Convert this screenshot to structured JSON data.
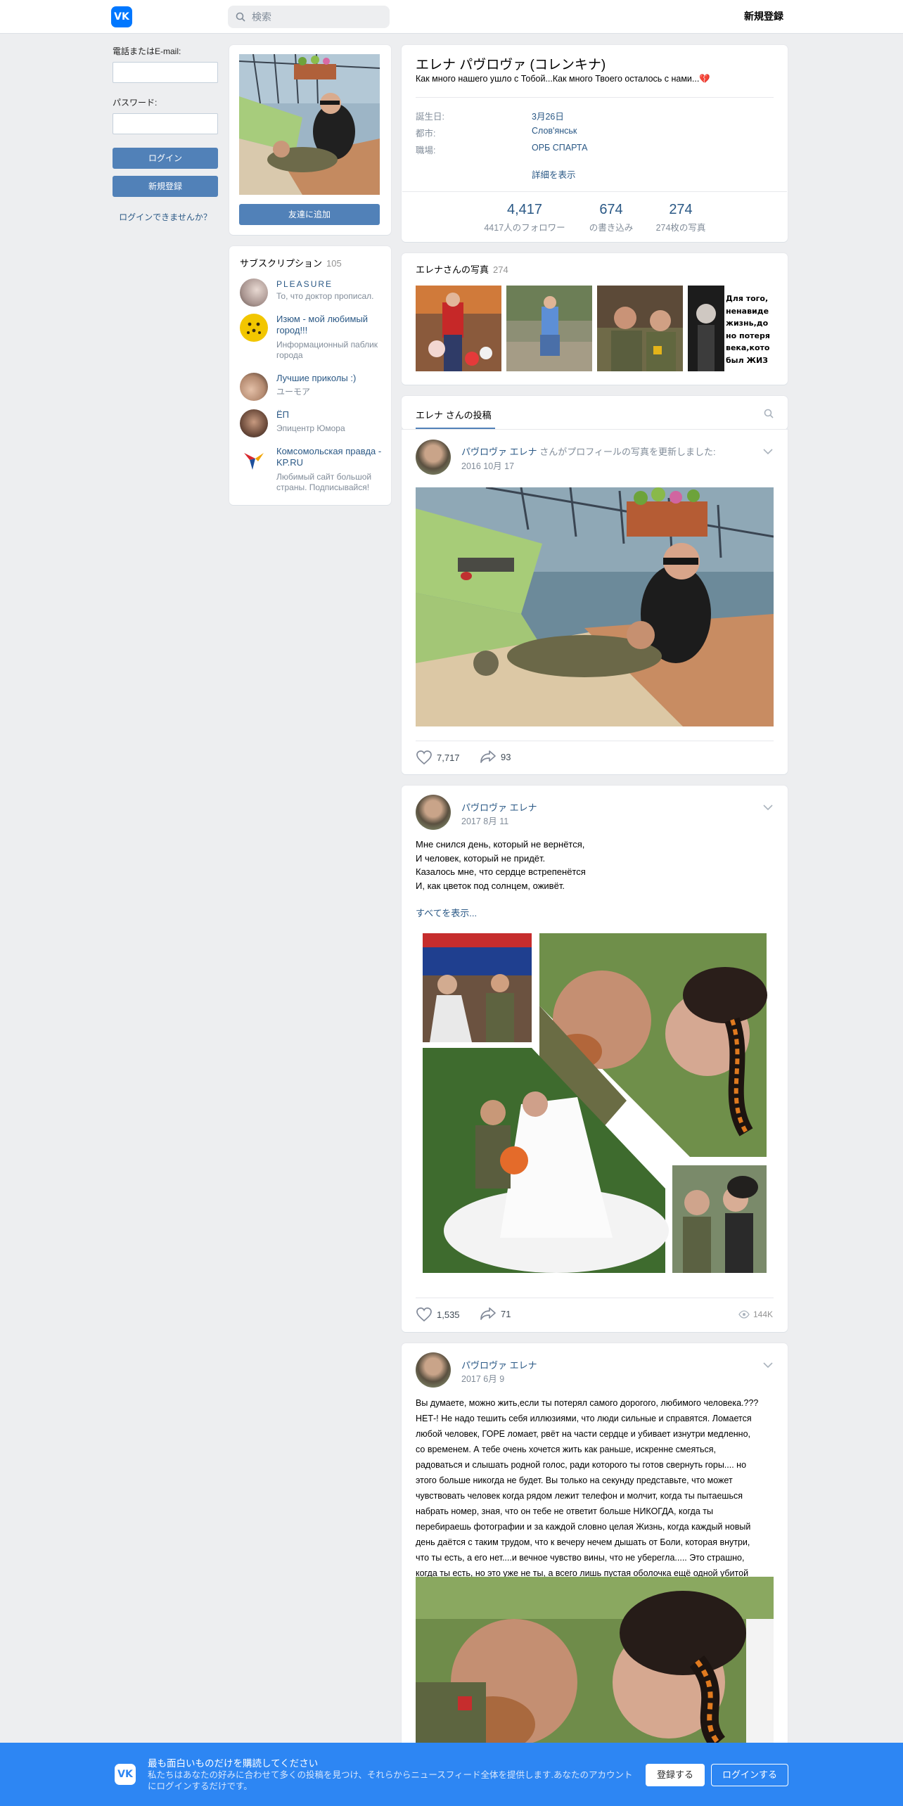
{
  "header": {
    "logo_text": "VK",
    "search_placeholder": "検索",
    "register_label": "新規登録"
  },
  "login": {
    "phone_label": "電話またはE-mail:",
    "password_label": "パスワード:",
    "login_button": "ログイン",
    "register_button": "新規登録",
    "forgot_link": "ログインできませんか？"
  },
  "profile": {
    "add_friend_button": "友達に追加",
    "name": "エレナ パヴロヴァ (コレンキナ)",
    "status": "Как много нашего ушло с Тобой...Как много Твоего осталось с нами...💔",
    "info": [
      {
        "label": "誕生日:",
        "value": "3月26日"
      },
      {
        "label": "都市:",
        "value": "Слов'янськ"
      },
      {
        "label": "職場:",
        "value": "ОРБ СПАРТА"
      }
    ],
    "show_more": "詳細を表示",
    "stats": [
      {
        "number": "4,417",
        "label": "4417人のフォロワー"
      },
      {
        "number": "674",
        "label": "の書き込み"
      },
      {
        "number": "274",
        "label": "274枚の写真"
      }
    ]
  },
  "subscriptions": {
    "title": "サブスクリプション",
    "count": "105",
    "items": [
      {
        "name": "PLEASURE",
        "desc": "То, что доктор прописал."
      },
      {
        "name": "Изюм - мой любимый город!!!",
        "desc": "Информационный паблик города"
      },
      {
        "name": "Лучшие приколы :)",
        "desc": "ユーモア"
      },
      {
        "name": "ЁП",
        "desc": "Эпицентр Юмора"
      },
      {
        "name": "Комсомольская правда - KP.RU",
        "desc": "Любимый сайт большой страны. Подписывайся!"
      }
    ]
  },
  "photos": {
    "title": "エレナさんの写真",
    "count": "274",
    "caption_text": "Для того, ненавиде жизнь,до но потеря века,кото был ЖИЗ"
  },
  "wall": {
    "tab_label": "エレナ さんの投稿"
  },
  "posts": [
    {
      "author": "パヴロヴァ エレナ",
      "action": "さんがプロフィールの写真を更新しました:",
      "date": "2016 10月 17",
      "likes": "7,717",
      "shares": "93"
    },
    {
      "author": "パヴロヴァ エレナ",
      "date": "2017 8月 11",
      "text": "Мне снился день, который не вернётся,\nИ человек, который не придёт.\nКазалось мне, что сердце встрепенётся\nИ, как цветок под солнцем, оживёт.",
      "show_all": "すべてを表示...",
      "likes": "1,535",
      "shares": "71",
      "views": "144K"
    },
    {
      "author": "パヴロヴァ エレナ",
      "date": "2017 6月 9",
      "text": "Вы думаете, можно жить,если ты потерял самого дорогого, любимого человека.???\nНЕТ-! Не надо тешить себя иллюзиями, что люди сильные и справятся. Ломается\nлюбой человек, ГОРЕ ломает, рвёт на части сердце и убивает изнутри медленно,\nсо временем. А тебе очень хочется жить как раньше, искренне смеяться,\nрадоваться и слышать родной голос, ради которого ты готов свернуть горы.... но\nэтого больше никогда не будет. Вы только на секунду представьте, что может\nчувствовать человек когда рядом лежит телефон и молчит, когда ты пытаешься\nнабрать номер, зная, что он тебе не ответит больше НИКОГДА, когда ты\nперебираешь фотографии и за каждой словно целая Жизнь, когда каждый новый\nдень даётся с таким трудом, что к вечеру нечем дышать от Боли, которая внутри,\nчто ты есть, а его нет....и вечное чувство вины, что не уберегла..... Это страшно,\nкогда ты есть, но это уже не ты, а всего лишь пустая оболочка ещё одной убитой\nгорем души..."
    }
  ],
  "banner": {
    "logo_text": "VK",
    "title": "最も面白いものだけを購読してください",
    "body": "私たちはあなたの好みに合わせて多くの投稿を見つけ、それらからニュースフィード全体を提供します.あなたのアカウントにログインするだけです。",
    "register_button": "登録する",
    "login_button": "ログインする"
  },
  "colors": {
    "accent": "#5181b8",
    "link": "#2a5885",
    "banner": "#2d86f3",
    "background": "#edeef0"
  }
}
